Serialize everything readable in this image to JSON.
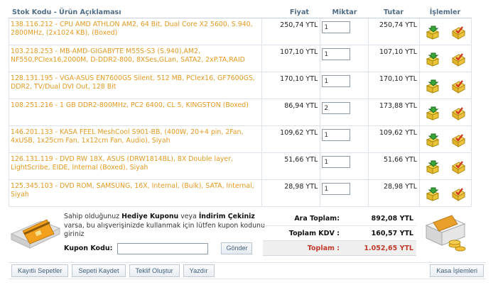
{
  "table": {
    "headers": {
      "description": "Stok Kodu - Ürün Açıklaması",
      "price": "Fiyat",
      "quantity": "Miktar",
      "total": "Tutar",
      "operations": "İşlemler"
    },
    "rows": [
      {
        "description": "138.116.212 - CPU AMD ATHLON AM2, 64 Bit, Dual Core X2 5600, S.940, 2800MHz, (2x1024 KB), (Boxed)",
        "price": "250,74 YTL",
        "qty": "1",
        "total": "250,74 YTL"
      },
      {
        "description": "103.218.253 - MB-AMD-GIGABYTE M55S-S3 (S.940),AM2, NF550,PCIex16,2000M, D-DDR2-800, 8XSes,GLan, SATA2, 2xP.TA,RAID",
        "price": "107,10 YTL",
        "qty": "1",
        "total": "107,10 YTL"
      },
      {
        "description": "128.131.195 - VGA-ASUS EN7600GS Silent, 512 MB, PCIex16, GF7600GS, DDR2, TV/Dual DVI Out, 128 Bit",
        "price": "170,10 YTL",
        "qty": "1",
        "total": "170,10 YTL"
      },
      {
        "description": "108.251.216 - 1 GB DDR2-800MHz, PC2 6400, CL 5, KINGSTON (Boxed)",
        "price": "86,94 YTL",
        "qty": "2",
        "total": "173,88 YTL"
      },
      {
        "description": "146.201.133 - KASA FEEL MeshCool S901-BB, (400W, 20+4 pin, 2Fan, 4xUSB, 1x25cm Fan, 1x12cm Fan, Audio), Siyah",
        "price": "109,62 YTL",
        "qty": "1",
        "total": "109,62 YTL"
      },
      {
        "description": "126.131.119 - DVD RW 18X, ASUS (DRW1814BL), 8X Double layer, LightScribe, EIDE, Internal (Boxed), Siyah",
        "price": "51,66 YTL",
        "qty": "1",
        "total": "51,66 YTL"
      },
      {
        "description": "125.345.103 - DVD ROM, SAMSUNG, 16X, Internal, (Bulk), SATA, Internal, Siyah",
        "price": "28,98 YTL",
        "qty": "1",
        "total": "28,98 YTL"
      }
    ]
  },
  "coupon": {
    "text_1": "Sahip olduğunuz ",
    "bold_1": "Hediye Kuponu",
    "text_2": " veya ",
    "bold_2": "İndirim Çekiniz",
    "text_3": " varsa, bu alışverişinizde kullanmak için lütfen kupon kodunu giriniz",
    "label": "Kupon Kodu:",
    "value": "",
    "button": "Gönder"
  },
  "summary": {
    "subtotal_label": "Ara Toplam:",
    "subtotal_value": "892,08 YTL",
    "tax_label": "Toplam KDV :",
    "tax_value": "160,57 YTL",
    "grand_label": "Toplam :",
    "grand_value": "1.052,65 YTL"
  },
  "footer": {
    "saved_carts": "Kayıtlı Sepetler",
    "save_cart": "Sepeti Kaydet",
    "create_offer": "Teklif Oluştur",
    "print": "Yazdır",
    "checkout": "Kasa İşlemleri"
  },
  "icons": {
    "row_action_1": "basket-green-arrow-icon",
    "row_action_2": "tag-red-check-icon"
  },
  "colors": {
    "accent_orange": "#e39a22",
    "header_blue": "#516d86",
    "grand_total_red": "#c0392b"
  }
}
